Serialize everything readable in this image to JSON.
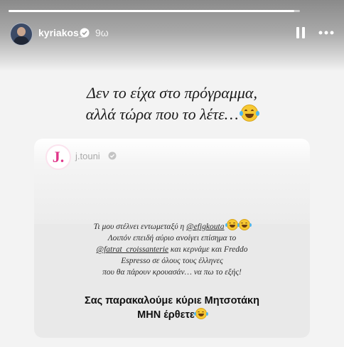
{
  "story": {
    "progress_fraction": 0.98,
    "username": "kyriakos_",
    "time_ago": "9ω",
    "verified": true,
    "icons": {
      "pause": "pause-icon",
      "more": "more-icon",
      "verified": "verified-badge-icon"
    },
    "caption": {
      "line1": "Δεν το είχα στο πρόγραμμα,",
      "line2": "αλλά τώρα που το λέτε…",
      "emoji": "face-with-tears-of-joy"
    }
  },
  "shared_post": {
    "avatar_letter": "J.",
    "username": "j.touni",
    "verified": true,
    "body": {
      "line1_prefix": "Τι μου στέλνει εντωμεταξύ η ",
      "line1_mention": "@efigkouta",
      "line2": "Λοιπόν επειδή αύριο ανοίγει επίσημα το",
      "line3_mention": "@fatrat_croissanterie",
      "line3_suffix": " και κερνάμε και Freddo",
      "line4": "Espresso σε όλους τους έλληνες",
      "line5": "που θα πάρουν κρουασάν… να πω το εξής!"
    },
    "bold": {
      "line1": "Σας παρακαλούμε κύριε Μητσοτάκη",
      "line2": "ΜΗΝ έρθετε"
    }
  },
  "colors": {
    "accent_logo": "#e0368a",
    "background": "#f3f3f3",
    "card": "#e9e9e9"
  }
}
